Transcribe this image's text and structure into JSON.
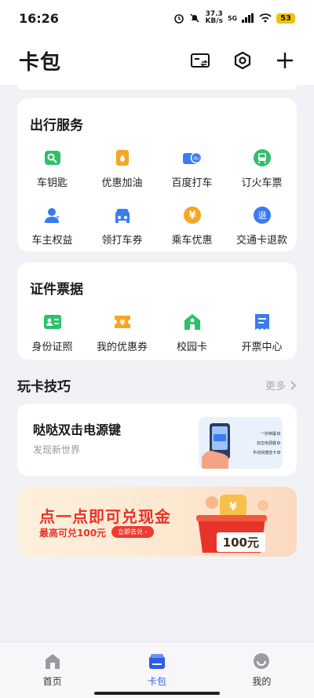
{
  "status": {
    "time": "16:26",
    "speed_top": "37.3",
    "speed_bottom": "KB/s",
    "network": "5G",
    "battery": "53"
  },
  "header": {
    "title": "卡包"
  },
  "travel": {
    "title": "出行服务",
    "items": [
      {
        "label": "车钥匙",
        "icon": "car-key-icon",
        "color": "#2fc06a"
      },
      {
        "label": "优惠加油",
        "icon": "fuel-icon",
        "color": "#f6a623"
      },
      {
        "label": "百度打车",
        "icon": "taxi-icon",
        "color": "#3a7bf0"
      },
      {
        "label": "订火车票",
        "icon": "train-icon",
        "color": "#2fc06a"
      },
      {
        "label": "车主权益",
        "icon": "owner-icon",
        "color": "#3a7bf0"
      },
      {
        "label": "领打车券",
        "icon": "car-coupon-icon",
        "color": "#3a7bf0"
      },
      {
        "label": "乘车优惠",
        "icon": "yen-coin-icon",
        "color": "#f6a623"
      },
      {
        "label": "交通卡退款",
        "icon": "refund-icon",
        "color": "#3a7bf0"
      }
    ]
  },
  "docs": {
    "title": "证件票据",
    "items": [
      {
        "label": "身份证照",
        "icon": "id-card-icon",
        "color": "#2fc06a"
      },
      {
        "label": "我的优惠券",
        "icon": "coupon-icon",
        "color": "#f6a623"
      },
      {
        "label": "校园卡",
        "icon": "school-icon",
        "color": "#2fc06a"
      },
      {
        "label": "开票中心",
        "icon": "invoice-icon",
        "color": "#3a7bf0"
      }
    ]
  },
  "tips": {
    "title": "玩卡技巧",
    "more": "更多",
    "card_title": "哒哒双击电源键",
    "card_sub": "发现新世界",
    "illu_lines": [
      "一秒唤醒",
      "双击电源键",
      "手动快捷选卡"
    ]
  },
  "banner": {
    "title": "点一点即可兑现金",
    "sub": "最高可兑100元",
    "button": "立即去兑 ›",
    "amount": "100元"
  },
  "tabs": [
    {
      "label": "首页",
      "icon": "home-icon",
      "active": false
    },
    {
      "label": "卡包",
      "icon": "wallet-icon",
      "active": true
    },
    {
      "label": "我的",
      "icon": "smile-icon",
      "active": false
    }
  ],
  "colors": {
    "accent": "#2f5bea",
    "green": "#2fc06a",
    "orange": "#f6a623",
    "blue": "#3a7bf0",
    "red": "#e8332a"
  }
}
